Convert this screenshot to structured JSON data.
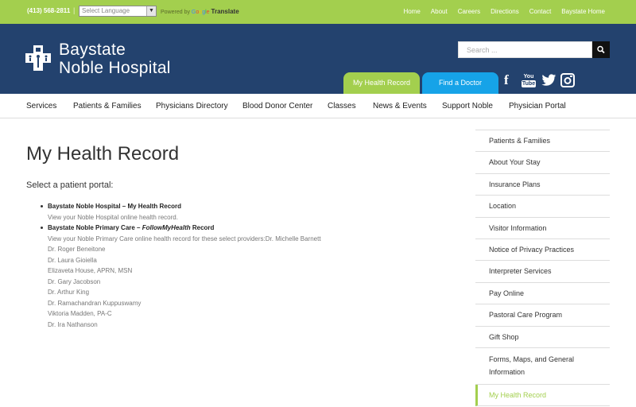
{
  "topbar": {
    "phone": "(413) 568-2811",
    "separator": "|",
    "language_select": "Select Language",
    "powered_by": "Powered by",
    "google": [
      "G",
      "o",
      "o",
      "g",
      "l",
      "e"
    ],
    "translate": "Translate",
    "links": [
      "Home",
      "About",
      "Careers",
      "Directions",
      "Contact",
      "Baystate Home"
    ]
  },
  "header": {
    "brand_line1": "Baystate",
    "brand_line2": "Noble Hospital",
    "search_placeholder": "Search ...",
    "tab_health_record": "My Health Record",
    "tab_find_doctor": "Find a Doctor",
    "youtube_top": "You",
    "youtube_bottom": "Tube"
  },
  "nav": [
    "Services",
    "Patients & Families",
    "Physicians Directory",
    "Blood Donor Center",
    "Classes",
    "News & Events",
    "Support Noble",
    "Physician Portal"
  ],
  "main": {
    "title": "My Health Record",
    "intro": "Select a patient portal:",
    "portal1": {
      "title": "Baystate Noble Hospital – My Health Record",
      "desc": "View your Noble Hospital online health record."
    },
    "portal2": {
      "title_prefix": "Baystate Noble Primary Care – ",
      "title_italic": "FollowMyHealth",
      "title_suffix": " Record",
      "desc": "View your Noble Primary Care online health record for these select providers:Dr. Michelle Barnett",
      "providers": [
        "Dr. Roger Beneitone",
        "Dr. Laura Gioiella",
        "Elizaveta House, APRN, MSN",
        "Dr. Gary Jacobson",
        "Dr. Arthur King",
        "Dr. Ramachandran Kuppuswamy",
        "Viktoria Madden, PA-C",
        "Dr. Ira Nathanson"
      ]
    }
  },
  "sidebar": [
    "Patients & Families",
    "About Your Stay",
    "Insurance Plans",
    "Location",
    "Visitor Information",
    "Notice of Privacy Practices",
    "Interpreter Services",
    "Pay Online",
    "Pastoral Care Program",
    "Gift Shop",
    "Forms, Maps, and General Information",
    "My Health Record"
  ],
  "colors": {
    "green": "#a3cf4e",
    "navy": "#23426e",
    "blue": "#16a3e8"
  }
}
